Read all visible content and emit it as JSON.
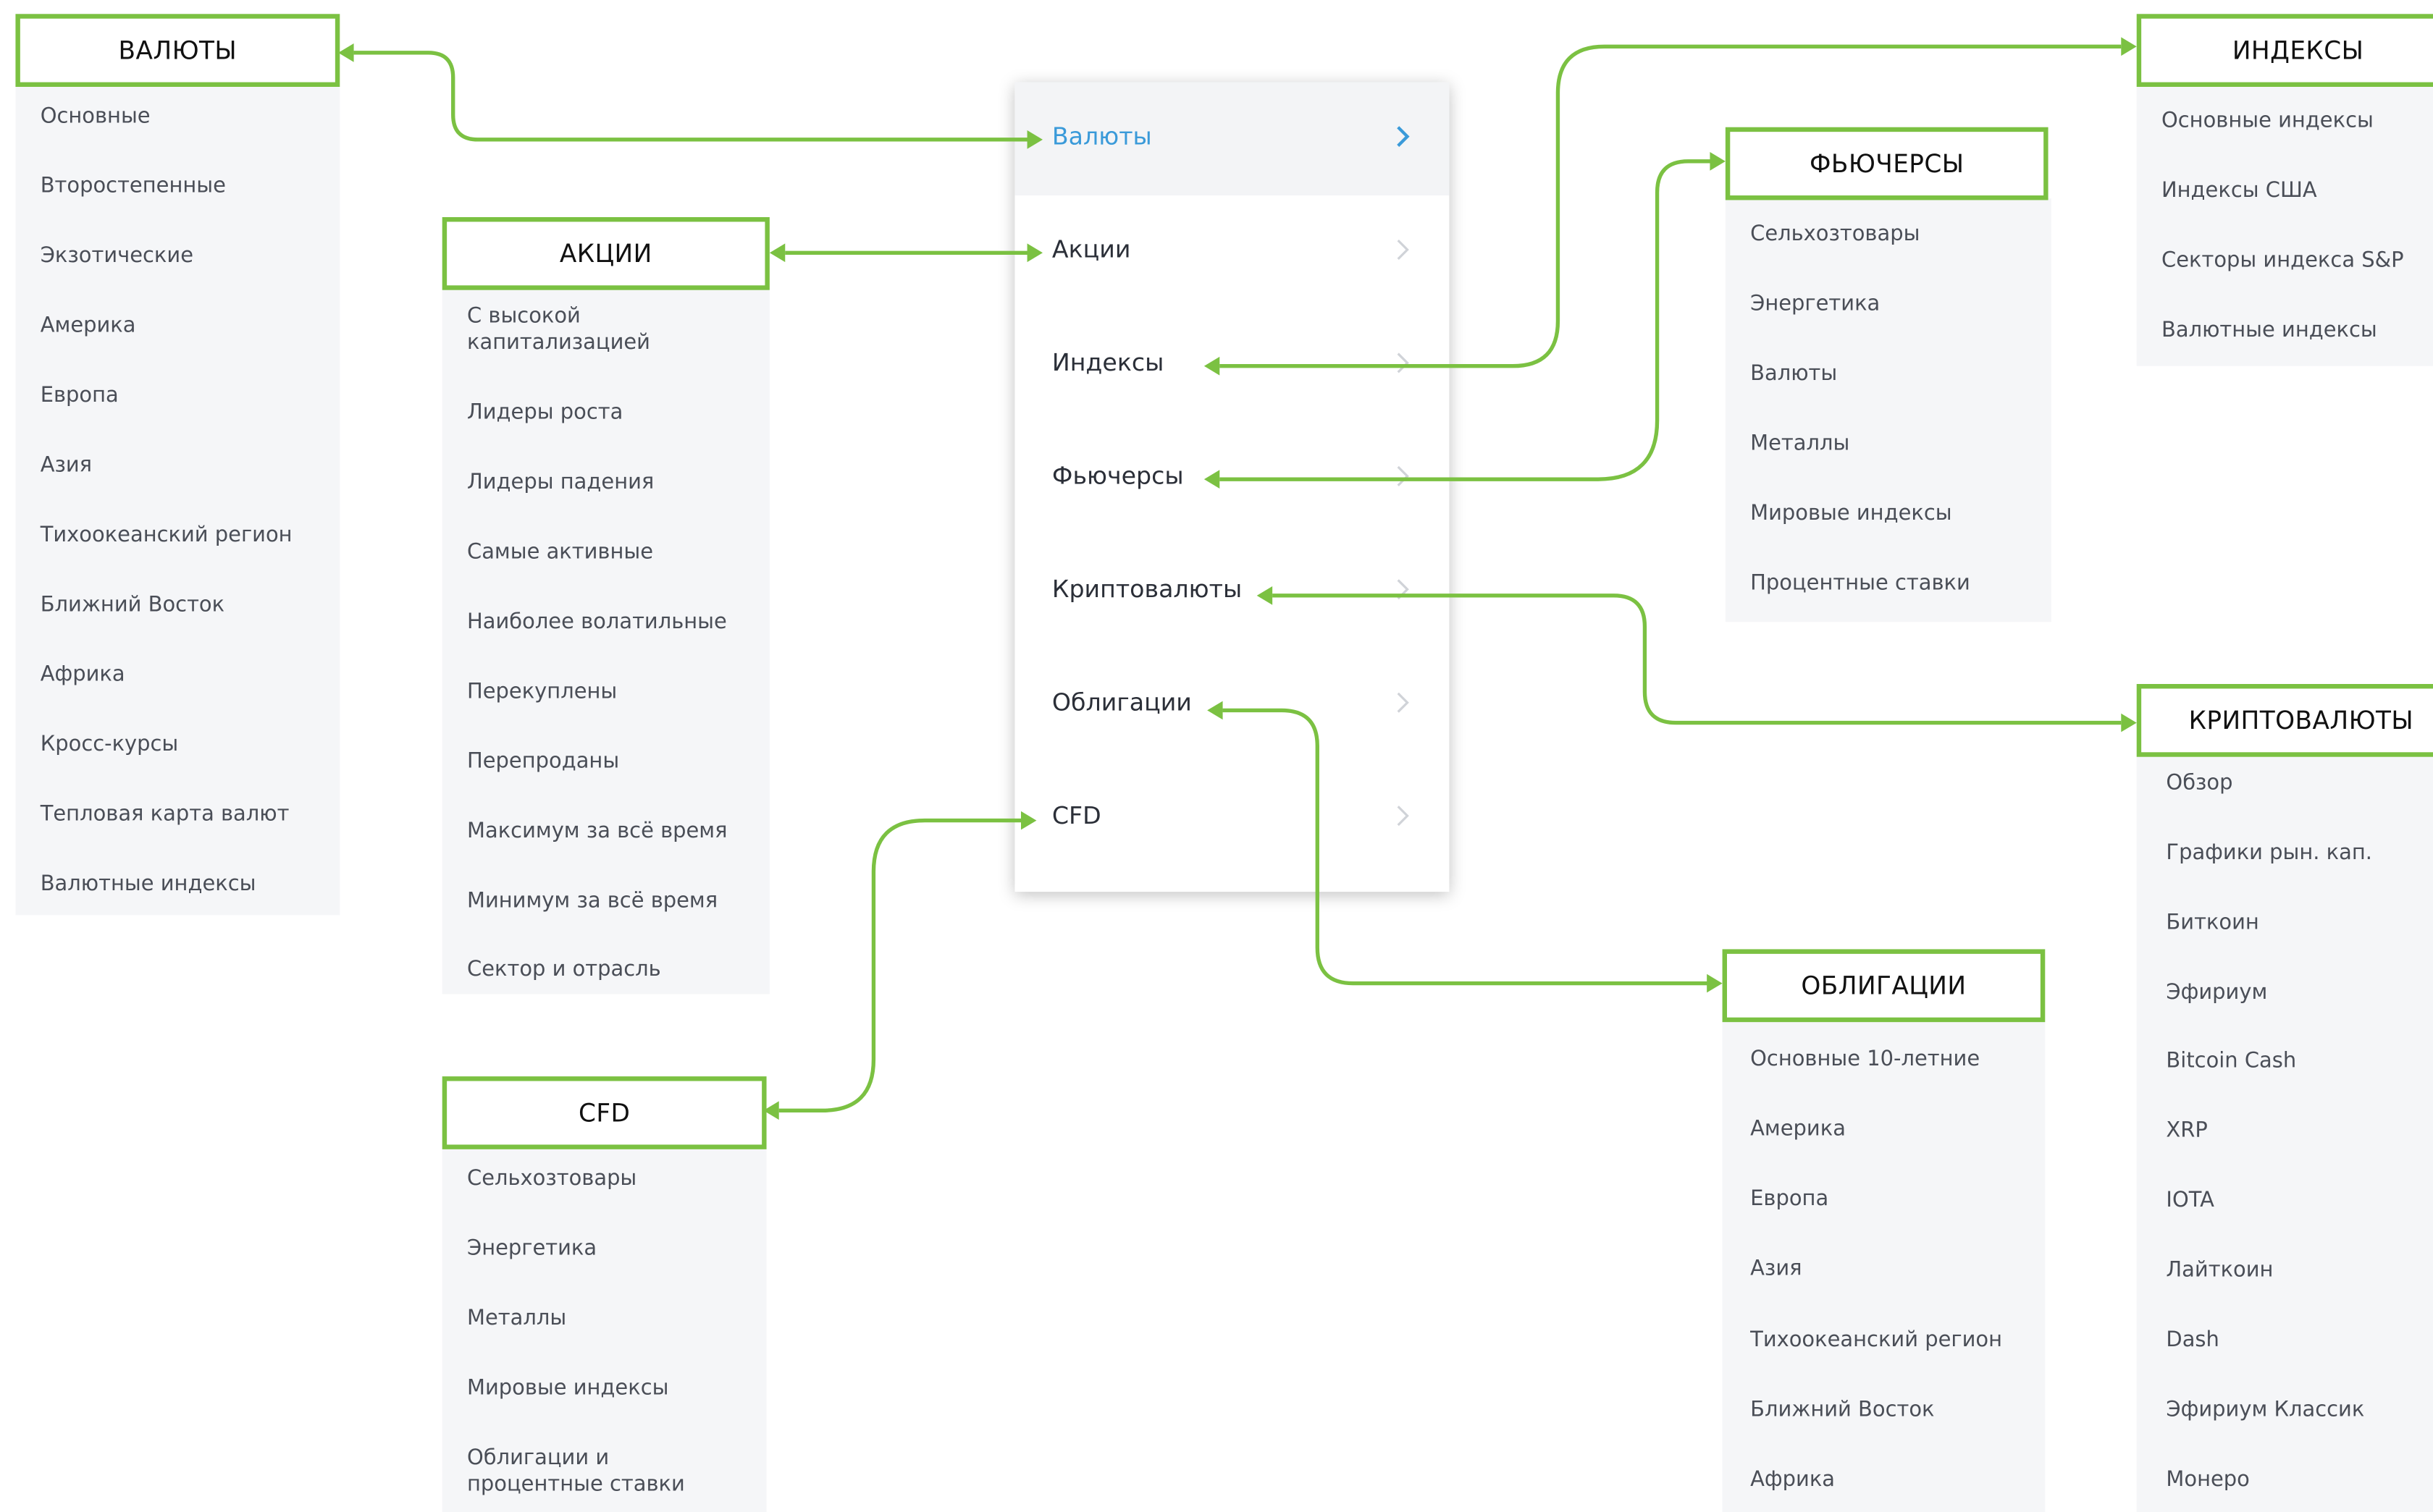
{
  "menu": {
    "items": [
      {
        "label": "Валюты",
        "active": true
      },
      {
        "label": "Акции",
        "active": false
      },
      {
        "label": "Индексы",
        "active": false
      },
      {
        "label": "Фьючерсы",
        "active": false
      },
      {
        "label": "Криптовалюты",
        "active": false
      },
      {
        "label": "Облигации",
        "active": false
      },
      {
        "label": "CFD",
        "active": false
      }
    ]
  },
  "panels": {
    "currencies": {
      "title": "ВАЛЮТЫ",
      "items": [
        "Основные",
        "Второстепенные",
        "Экзотические",
        "Америка",
        "Европа",
        "Азия",
        "Тихоокеанский регион",
        "Ближний Восток",
        "Африка",
        "Кросс-курсы",
        "Тепловая карта валют",
        "Валютные индексы"
      ]
    },
    "stocks": {
      "title": "АКЦИИ",
      "items": [
        "С высокой капитализацией",
        "Лидеры роста",
        "Лидеры падения",
        "Самые активные",
        "Наиболее волатильные",
        "Перекуплены",
        "Перепроданы",
        "Максимум за всё время",
        "Минимум за всё время",
        "Сектор и отрасль"
      ]
    },
    "cfd": {
      "title": "CFD",
      "items": [
        "Сельхозтовары",
        "Энергетика",
        "Металлы",
        "Мировые индексы",
        "Облигации и процентные ставки"
      ]
    },
    "futures": {
      "title": "ФЬЮЧЕРСЫ",
      "items": [
        "Сельхозтовары",
        "Энергетика",
        "Валюты",
        "Металлы",
        "Мировые индексы",
        "Процентные ставки"
      ]
    },
    "indices": {
      "title": "ИНДЕКСЫ",
      "items": [
        "Основные индексы",
        "Индексы США",
        "Секторы индекса S&P",
        "Валютные индексы"
      ]
    },
    "crypto": {
      "title": "КРИПТОВАЛЮТЫ",
      "items": [
        "Обзор",
        "Графики рын. кап.",
        "Биткоин",
        "Эфириум",
        "Bitcoin Cash",
        "XRP",
        "IOTA",
        "Лайткоин",
        "Dash",
        "Эфириум Классик",
        "Монеро"
      ]
    },
    "bonds": {
      "title": "ОБЛИГАЦИИ",
      "items": [
        "Основные 10-летние",
        "Америка",
        "Европа",
        "Азия",
        "Тихоокеанский регион",
        "Ближний Восток",
        "Африка"
      ]
    }
  },
  "colors": {
    "connector": "#7bc142",
    "active_text": "#3a9ad9",
    "panel_bg": "#f5f6f8"
  }
}
